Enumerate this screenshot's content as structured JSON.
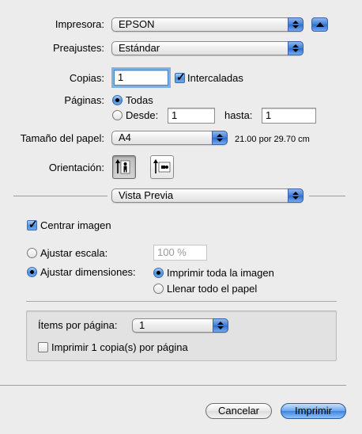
{
  "printer": {
    "label": "Impresora:",
    "value": "EPSON"
  },
  "presets": {
    "label": "Preajustes:",
    "value": "Estándar"
  },
  "copies": {
    "label": "Copias:",
    "value": "1",
    "collated_label": "Intercaladas",
    "collated_checked": true
  },
  "pages": {
    "label": "Páginas:",
    "all_label": "Todas",
    "from_label": "Desde:",
    "from_value": "1",
    "to_label": "hasta:",
    "to_value": "1",
    "selected": "all"
  },
  "paper_size": {
    "label": "Tamaño del papel:",
    "value": "A4",
    "dimensions": "21.00 por 29.70 cm"
  },
  "orientation": {
    "label": "Orientación:",
    "selected": "portrait"
  },
  "panel": {
    "value": "Vista Previa"
  },
  "preview": {
    "center_image_label": "Centrar imagen",
    "center_image_checked": true,
    "scale_label": "Ajustar escala:",
    "scale_value": "100 %",
    "fit_label": "Ajustar dimensiones:",
    "fit_selected": true,
    "print_entire_label": "Imprimir toda la imagen",
    "fill_paper_label": "Llenar todo el papel",
    "fit_mode": "entire"
  },
  "layout": {
    "items_per_page_label": "Ítems por página:",
    "items_per_page_value": "1",
    "one_copy_label": "Imprimir 1 copia(s) por página",
    "one_copy_checked": false
  },
  "buttons": {
    "cancel": "Cancelar",
    "print": "Imprimir"
  }
}
